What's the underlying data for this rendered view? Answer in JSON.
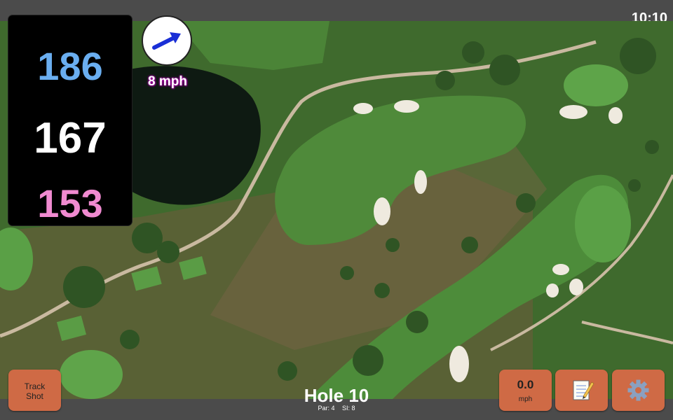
{
  "status": {
    "clock": "10:10"
  },
  "distances": {
    "back": "186",
    "middle": "167",
    "front": "153"
  },
  "wind": {
    "speed_label": "8 mph",
    "direction_icon": "arrow-icon"
  },
  "hole": {
    "title": "Hole 10",
    "par_label": "Par: 4",
    "si_label": "SI: 8"
  },
  "buttons": {
    "track_shot": {
      "line1": "Track",
      "line2": "Shot"
    },
    "wind_speed": {
      "value": "0.0",
      "unit": "mph"
    },
    "notes": {
      "icon": "notepad-icon"
    },
    "settings": {
      "icon": "gear-icon"
    }
  },
  "colors": {
    "back": "#6aaef0",
    "middle": "#ffffff",
    "front": "#f08ad0",
    "button": "#cf6a45"
  }
}
